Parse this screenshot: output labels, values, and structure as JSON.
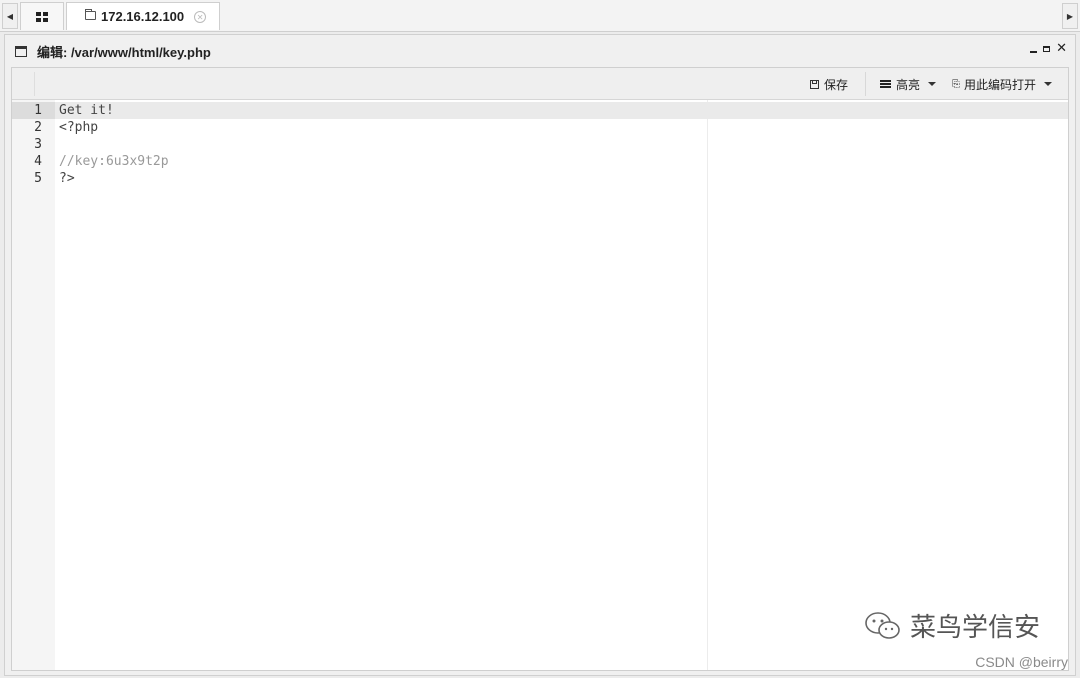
{
  "tabs": {
    "home_icon": "grid-icon",
    "connection": {
      "label": "172.16.12.100",
      "icon": "folder-icon",
      "close_icon": "close-circle-icon"
    }
  },
  "window": {
    "title": "编辑: /var/www/html/key.php",
    "controls": [
      "minimize-icon",
      "restore-icon",
      "close-icon"
    ]
  },
  "toolbar": {
    "save_label": "保存",
    "highlight_label": "高亮",
    "encoding_label": "用此编码打开"
  },
  "editor": {
    "lines": [
      {
        "num": "1",
        "text": "Get it!",
        "active": true
      },
      {
        "num": "2",
        "text": "<?php"
      },
      {
        "num": "3",
        "text": ""
      },
      {
        "num": "4",
        "text": "//key:6u3x9t2p",
        "comment": true
      },
      {
        "num": "5",
        "text": "?>"
      }
    ]
  },
  "watermark": {
    "brand": "菜鸟学信安",
    "csdn": "CSDN @beirry"
  }
}
